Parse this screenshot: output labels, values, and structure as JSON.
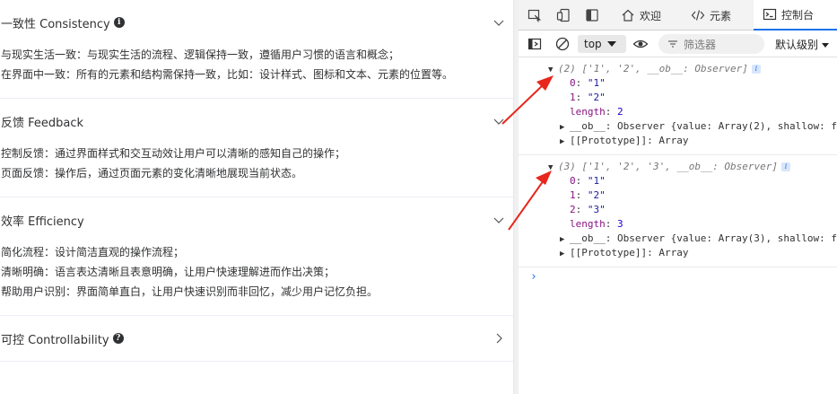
{
  "collapse": {
    "items": [
      {
        "title": "一致性 Consistency",
        "has_info": true,
        "expanded": true,
        "lines": [
          "与现实生活一致：与现实生活的流程、逻辑保持一致，遵循用户习惯的语言和概念；",
          "在界面中一致：所有的元素和结构需保持一致，比如：设计样式、图标和文本、元素的位置等。"
        ]
      },
      {
        "title": "反馈 Feedback",
        "has_info": false,
        "expanded": true,
        "lines": [
          "控制反馈：通过界面样式和交互动效让用户可以清晰的感知自己的操作；",
          "页面反馈：操作后，通过页面元素的变化清晰地展现当前状态。"
        ]
      },
      {
        "title": "效率 Efficiency",
        "has_info": false,
        "expanded": true,
        "lines": [
          "简化流程：设计简洁直观的操作流程；",
          "清晰明确：语言表达清晰且表意明确，让用户快速理解进而作出决策；",
          "帮助用户识别：界面简单直白，让用户快速识别而非回忆，减少用户记忆负担。"
        ]
      },
      {
        "title": "可控 Controllability",
        "has_info": true,
        "expanded": false,
        "lines": []
      }
    ]
  },
  "devtools": {
    "tabs": [
      {
        "label": "欢迎",
        "icon": "home-icon"
      },
      {
        "label": "元素",
        "icon": "code-icon"
      },
      {
        "label": "控制台",
        "icon": "console-icon",
        "active": true
      }
    ],
    "toolbar": {
      "context": "top",
      "filter_placeholder": "筛选器",
      "level": "默认级别"
    },
    "console": {
      "messages": [
        {
          "summary": "(2) ['1', '2', __ob__: Observer]",
          "entries": [
            {
              "key": "0",
              "value": "\"1\""
            },
            {
              "key": "1",
              "value": "\"2\""
            },
            {
              "key": "length",
              "value": "2"
            }
          ],
          "ob": "__ob__: Observer {value: Array(2), shallow: f",
          "proto": "[[Prototype]]: Array"
        },
        {
          "summary": "(3) ['1', '2', '3', __ob__: Observer]",
          "entries": [
            {
              "key": "0",
              "value": "\"1\""
            },
            {
              "key": "1",
              "value": "\"2\""
            },
            {
              "key": "2",
              "value": "\"3\""
            },
            {
              "key": "length",
              "value": "3"
            }
          ],
          "ob": "__ob__: Observer {value: Array(3), shallow: f",
          "proto": "[[Prototype]]: Array"
        }
      ],
      "prompt": "›"
    }
  },
  "colors": {
    "accent": "#1a73e8",
    "annotation_arrow": "#e8261c"
  }
}
